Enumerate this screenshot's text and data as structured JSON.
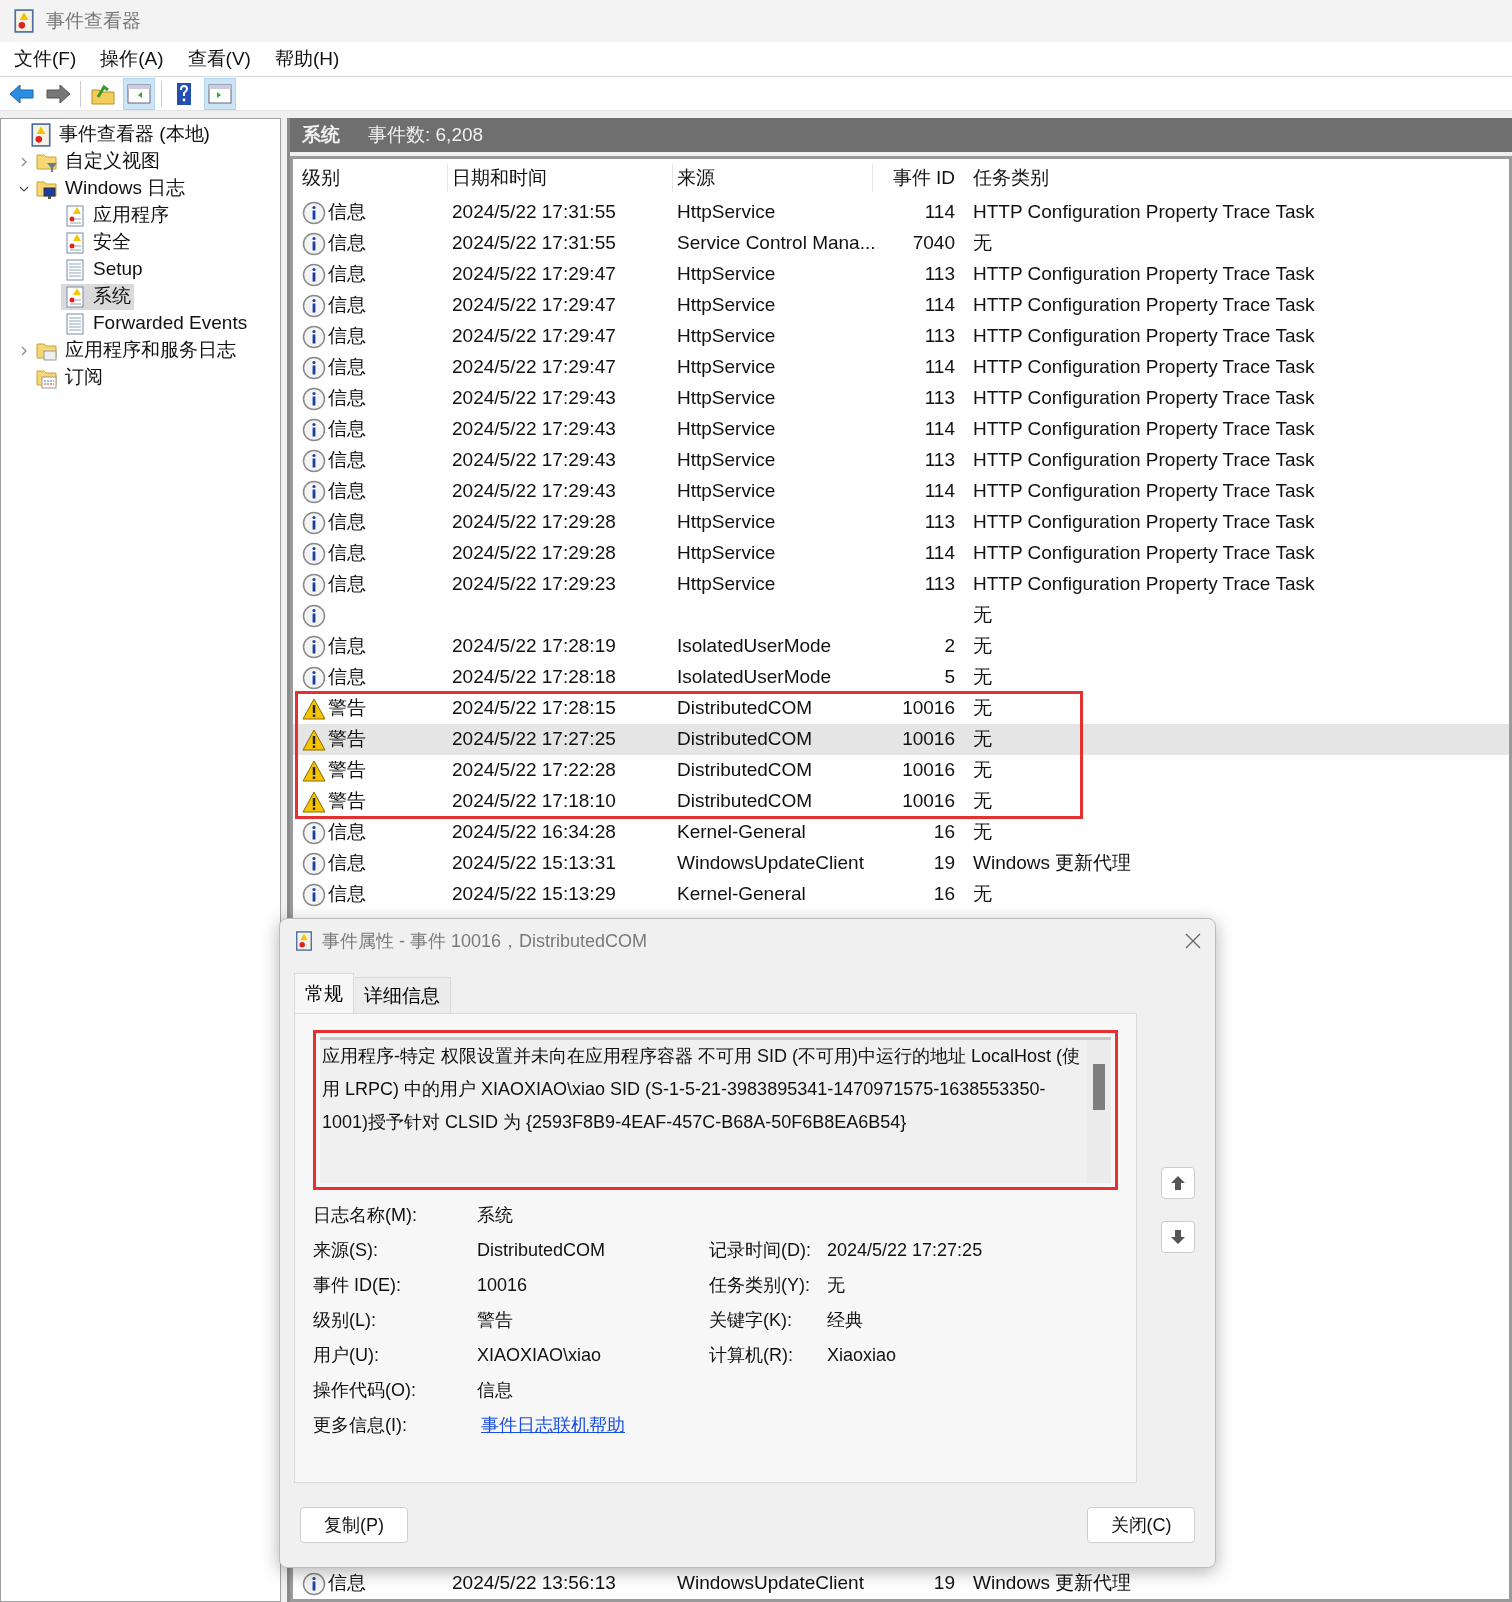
{
  "window": {
    "title": "事件查看器"
  },
  "menu": [
    "文件(F)",
    "操作(A)",
    "查看(V)",
    "帮助(H)"
  ],
  "toolbar": [
    {
      "kind": "back",
      "selected": false
    },
    {
      "kind": "forward",
      "selected": false
    },
    {
      "kind": "up",
      "selected": false
    },
    {
      "kind": "tree-pane",
      "selected": true
    },
    {
      "kind": "help",
      "selected": false
    },
    {
      "kind": "action-pane",
      "selected": true
    }
  ],
  "tree": [
    {
      "label": "事件查看器 (本地)",
      "kind": "viewer",
      "selected": false,
      "children": [
        {
          "label": "自定义视图",
          "kind": "filter-folder",
          "expanded": false,
          "selected": false
        },
        {
          "label": "Windows 日志",
          "kind": "monitor-folder",
          "expanded": true,
          "selected": false,
          "children": [
            {
              "label": "应用程序",
              "kind": "log",
              "selected": false
            },
            {
              "label": "安全",
              "kind": "log",
              "selected": false
            },
            {
              "label": "Setup",
              "kind": "list",
              "selected": false
            },
            {
              "label": "系统",
              "kind": "log",
              "selected": true
            },
            {
              "label": "Forwarded Events",
              "kind": "list",
              "selected": false
            }
          ]
        },
        {
          "label": "应用程序和服务日志",
          "kind": "folder",
          "expanded": false,
          "selected": false
        },
        {
          "label": "订阅",
          "kind": "subscription",
          "selected": false
        }
      ]
    }
  ],
  "header": {
    "log_name": "系统",
    "count": "事件数: 6,208"
  },
  "table": {
    "columns": [
      "级别",
      "日期和时间",
      "来源",
      "事件 ID",
      "任务类别"
    ],
    "rows": [
      {
        "kind": "info",
        "level": "信息",
        "datetime": "2024/5/22 17:31:55",
        "source": "HttpService",
        "event_id": "114",
        "task": "HTTP Configuration Property Trace Task",
        "selected": false,
        "highlighted": false
      },
      {
        "kind": "info",
        "level": "信息",
        "datetime": "2024/5/22 17:31:55",
        "source": "Service Control Mana...",
        "event_id": "7040",
        "task": "无",
        "selected": false,
        "highlighted": false
      },
      {
        "kind": "info",
        "level": "信息",
        "datetime": "2024/5/22 17:29:47",
        "source": "HttpService",
        "event_id": "113",
        "task": "HTTP Configuration Property Trace Task",
        "selected": false,
        "highlighted": false
      },
      {
        "kind": "info",
        "level": "信息",
        "datetime": "2024/5/22 17:29:47",
        "source": "HttpService",
        "event_id": "114",
        "task": "HTTP Configuration Property Trace Task",
        "selected": false,
        "highlighted": false
      },
      {
        "kind": "info",
        "level": "信息",
        "datetime": "2024/5/22 17:29:47",
        "source": "HttpService",
        "event_id": "113",
        "task": "HTTP Configuration Property Trace Task",
        "selected": false,
        "highlighted": false
      },
      {
        "kind": "info",
        "level": "信息",
        "datetime": "2024/5/22 17:29:47",
        "source": "HttpService",
        "event_id": "114",
        "task": "HTTP Configuration Property Trace Task",
        "selected": false,
        "highlighted": false
      },
      {
        "kind": "info",
        "level": "信息",
        "datetime": "2024/5/22 17:29:43",
        "source": "HttpService",
        "event_id": "113",
        "task": "HTTP Configuration Property Trace Task",
        "selected": false,
        "highlighted": false
      },
      {
        "kind": "info",
        "level": "信息",
        "datetime": "2024/5/22 17:29:43",
        "source": "HttpService",
        "event_id": "114",
        "task": "HTTP Configuration Property Trace Task",
        "selected": false,
        "highlighted": false
      },
      {
        "kind": "info",
        "level": "信息",
        "datetime": "2024/5/22 17:29:43",
        "source": "HttpService",
        "event_id": "113",
        "task": "HTTP Configuration Property Trace Task",
        "selected": false,
        "highlighted": false
      },
      {
        "kind": "info",
        "level": "信息",
        "datetime": "2024/5/22 17:29:43",
        "source": "HttpService",
        "event_id": "114",
        "task": "HTTP Configuration Property Trace Task",
        "selected": false,
        "highlighted": false
      },
      {
        "kind": "info",
        "level": "信息",
        "datetime": "2024/5/22 17:29:28",
        "source": "HttpService",
        "event_id": "113",
        "task": "HTTP Configuration Property Trace Task",
        "selected": false,
        "highlighted": false
      },
      {
        "kind": "info",
        "level": "信息",
        "datetime": "2024/5/22 17:29:28",
        "source": "HttpService",
        "event_id": "114",
        "task": "HTTP Configuration Property Trace Task",
        "selected": false,
        "highlighted": false
      },
      {
        "kind": "info",
        "level": "信息",
        "datetime": "2024/5/22 17:29:23",
        "source": "HttpService",
        "event_id": "113",
        "task": "HTTP Configuration Property Trace Task",
        "selected": false,
        "highlighted": false
      },
      {
        "kind": "info",
        "task": "无",
        "selected": false,
        "highlighted": false
      },
      {
        "kind": "info",
        "level": "信息",
        "datetime": "2024/5/22 17:28:19",
        "source": "IsolatedUserMode",
        "event_id": "2",
        "task": "无",
        "selected": false,
        "highlighted": false
      },
      {
        "kind": "info",
        "level": "信息",
        "datetime": "2024/5/22 17:28:18",
        "source": "IsolatedUserMode",
        "event_id": "5",
        "task": "无",
        "selected": false,
        "highlighted": false
      },
      {
        "kind": "warning",
        "level": "警告",
        "datetime": "2024/5/22 17:28:15",
        "source": "DistributedCOM",
        "event_id": "10016",
        "task": "无",
        "selected": false,
        "highlighted": true
      },
      {
        "kind": "warning",
        "level": "警告",
        "datetime": "2024/5/22 17:27:25",
        "source": "DistributedCOM",
        "event_id": "10016",
        "task": "无",
        "selected": true,
        "highlighted": true
      },
      {
        "kind": "warning",
        "level": "警告",
        "datetime": "2024/5/22 17:22:28",
        "source": "DistributedCOM",
        "event_id": "10016",
        "task": "无",
        "selected": false,
        "highlighted": true
      },
      {
        "kind": "warning",
        "level": "警告",
        "datetime": "2024/5/22 17:18:10",
        "source": "DistributedCOM",
        "event_id": "10016",
        "task": "无",
        "selected": false,
        "highlighted": true
      },
      {
        "kind": "info",
        "level": "信息",
        "datetime": "2024/5/22 16:34:28",
        "source": "Kernel-General",
        "event_id": "16",
        "task": "无",
        "selected": false,
        "highlighted": false
      },
      {
        "kind": "info",
        "level": "信息",
        "datetime": "2024/5/22 15:13:31",
        "source": "WindowsUpdateClient",
        "event_id": "19",
        "task": "Windows 更新代理",
        "selected": false,
        "highlighted": false
      },
      {
        "kind": "info",
        "level": "信息",
        "datetime": "2024/5/22 15:13:29",
        "source": "Kernel-General",
        "event_id": "16",
        "task": "无",
        "selected": false,
        "highlighted": false
      },
      {
        "kind": "info",
        "level": "信息",
        "datetime": "2024/5/22 13:56:13",
        "source": "WindowsUpdateClient",
        "event_id": "19",
        "task": "Windows 更新代理",
        "selected": false,
        "highlighted": false
      }
    ]
  },
  "dialog": {
    "title": "事件属性 - 事件 10016，DistributedCOM",
    "tabs": [
      {
        "label": "常规",
        "selected": true
      },
      {
        "label": "详细信息",
        "selected": false
      }
    ],
    "message": "应用程序-特定 权限设置并未向在应用程序容器 不可用 SID (不可用)中运行的地址 LocalHost (使用 LRPC) 中的用户 XIAOXIAO\\xiao SID (S-1-5-21-3983895341-1470971575-1638553350-1001)授予针对 CLSID 为 {2593F8B9-4EAF-457C-B68A-50F6B8EA6B54}",
    "message_highlighted": true,
    "fields": [
      {
        "left": {
          "label": "日志名称(M):",
          "value": "系统"
        }
      },
      {
        "left": {
          "label": "来源(S):",
          "value": "DistributedCOM"
        },
        "right": {
          "label": "记录时间(D):",
          "value": "2024/5/22 17:27:25"
        }
      },
      {
        "left": {
          "label": "事件 ID(E):",
          "value": "10016"
        },
        "right": {
          "label": "任务类别(Y):",
          "value": "无"
        }
      },
      {
        "left": {
          "label": "级别(L):",
          "value": "警告"
        },
        "right": {
          "label": "关键字(K):",
          "value": "经典"
        }
      },
      {
        "left": {
          "label": "用户(U):",
          "value": "XIAOXIAO\\xiao"
        },
        "right": {
          "label": "计算机(R):",
          "value": "Xiaoxiao"
        }
      },
      {
        "left": {
          "label": "操作代码(O):",
          "value": "信息"
        }
      },
      {
        "left": {
          "label": "更多信息(I):",
          "value": "事件日志联机帮助",
          "kind": "link"
        }
      }
    ],
    "buttons": [
      "复制(P)",
      "关闭(C)"
    ]
  }
}
